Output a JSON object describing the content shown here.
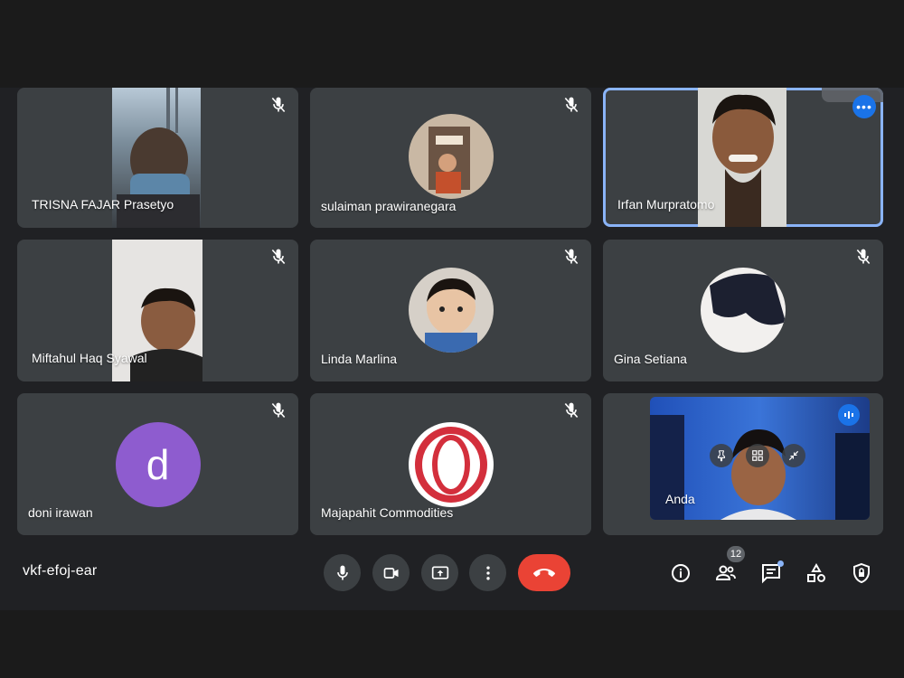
{
  "participants": [
    {
      "name": "TRISNA FAJAR Prasetyo",
      "muted": true
    },
    {
      "name": "sulaiman prawiranegara",
      "muted": true
    },
    {
      "name": "Irfan Murpratomo",
      "muted": false,
      "active": true
    },
    {
      "name": "Miftahul Haq Syawal",
      "muted": true
    },
    {
      "name": "Linda Marlina",
      "muted": true
    },
    {
      "name": "Gina Setiana",
      "muted": true
    },
    {
      "name": "doni irawan",
      "muted": true,
      "avatar_letter": "d"
    },
    {
      "name": "Majapahit Commodities",
      "muted": true
    },
    {
      "name": "Anda",
      "muted": false
    }
  ],
  "meeting": {
    "code": "vkf-efoj-ear"
  },
  "controls": {
    "mic_icon": "microphone-icon",
    "camera_icon": "camera-icon",
    "present_icon": "present-screen-icon",
    "more_icon": "more-options-icon",
    "end_icon": "end-call-icon"
  },
  "right_controls": {
    "people_count": "12",
    "icons": [
      "info-icon",
      "people-icon",
      "chat-icon",
      "activities-icon",
      "host-controls-icon"
    ]
  },
  "colors": {
    "accent": "#8ab4f8",
    "end_call": "#ea4335",
    "tile_bg": "#3c4043",
    "letter_avatar": "#8e5ccf"
  }
}
